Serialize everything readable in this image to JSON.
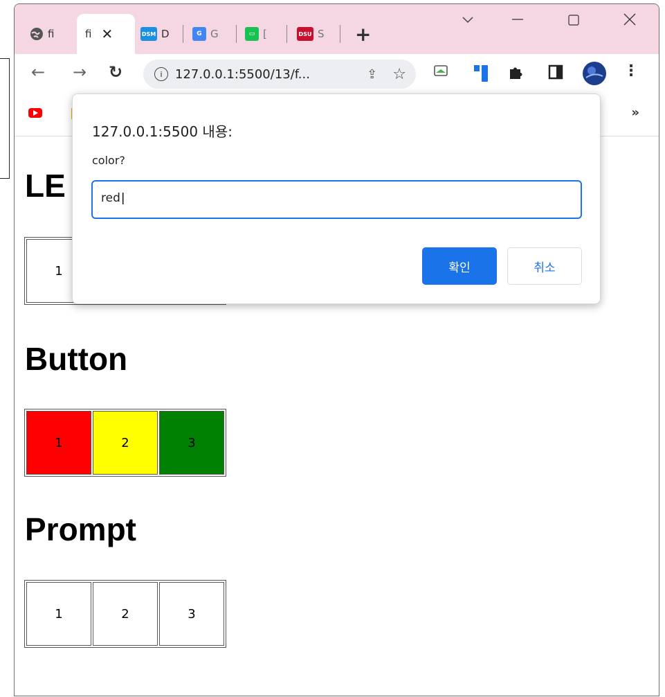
{
  "browser": {
    "tabs": [
      {
        "label": "fi",
        "favicon": "globe-icon"
      },
      {
        "label": "fi",
        "favicon": "file-icon",
        "active": true
      },
      {
        "label": "D",
        "favicon": "DSM"
      },
      {
        "label": "G",
        "favicon": "google-translate-icon"
      },
      {
        "label": "[",
        "favicon": "blog-icon"
      },
      {
        "label": "S",
        "favicon": "DSU"
      }
    ],
    "url": "127.0.0.1:5500/13/f...",
    "overflow_bookmarks": "»"
  },
  "page": {
    "sections": [
      {
        "title": "LE",
        "cells": [
          "1",
          "",
          ""
        ]
      },
      {
        "title": "Button",
        "cells": [
          "1",
          "2",
          "3"
        ],
        "colors": [
          "#ff0000",
          "#ffff00",
          "#008000"
        ]
      },
      {
        "title": "Prompt",
        "cells": [
          "1",
          "2",
          "3"
        ]
      }
    ]
  },
  "dialog": {
    "title": "127.0.0.1:5500 내용:",
    "message": "color?",
    "input_value": "red",
    "ok_label": "확인",
    "cancel_label": "취소"
  },
  "colors": {
    "titlebar": "#f5d6e3",
    "accent": "#1a73e8"
  }
}
